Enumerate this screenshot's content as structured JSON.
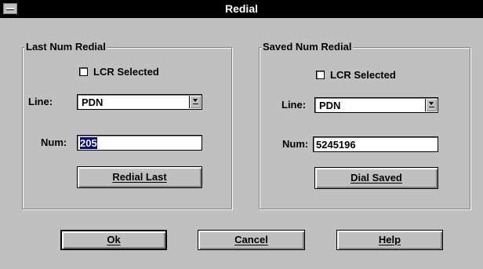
{
  "window": {
    "title": "Redial"
  },
  "last_num": {
    "group_title": "Last Num Redial",
    "lcr_label": "LCR Selected",
    "lcr_checked": false,
    "line_label": "Line:",
    "line_value": "PDN",
    "num_label": "Num:",
    "num_value": "205",
    "button_label": "Redial Last"
  },
  "saved_num": {
    "group_title": "Saved Num Redial",
    "lcr_label": "LCR Selected",
    "lcr_checked": false,
    "line_label": "Line:",
    "line_value": "PDN",
    "num_label": "Num:",
    "num_value": "5245196",
    "button_label": "Dial Saved"
  },
  "footer": {
    "ok_label": "Ok",
    "cancel_label": "Cancel",
    "help_label": "Help"
  },
  "colors": {
    "face": "#c0c0c0",
    "titlebar": "#000000",
    "selection": "#000080"
  }
}
